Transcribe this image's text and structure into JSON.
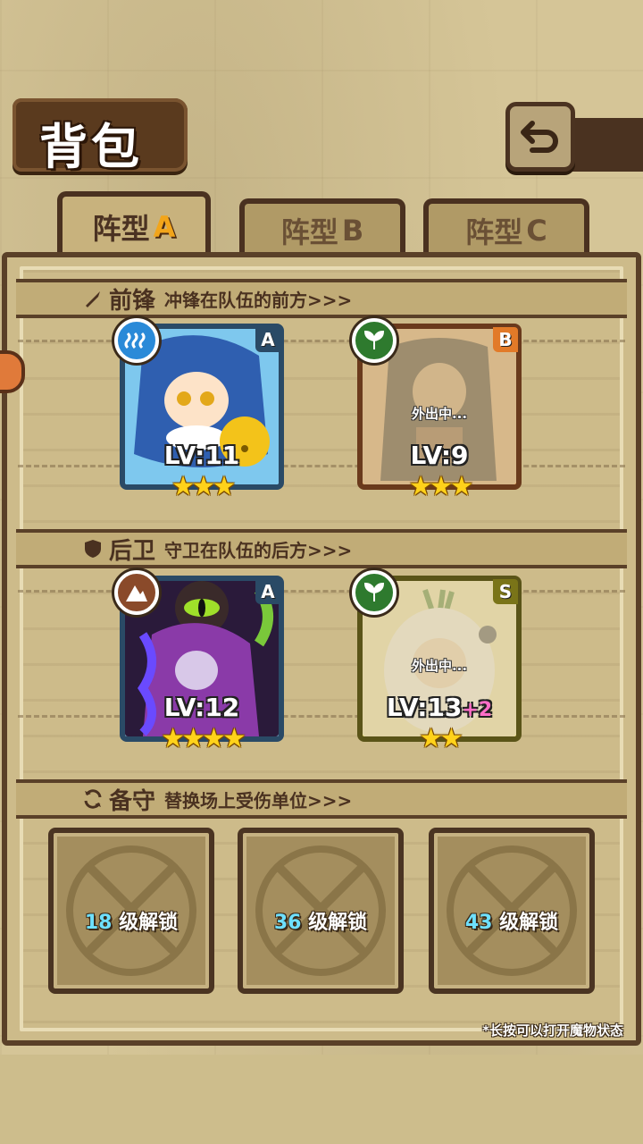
{
  "header": {
    "title": "背包"
  },
  "tabs": [
    {
      "label": "阵型",
      "letter": "A",
      "active": true
    },
    {
      "label": "阵型",
      "letter": "B",
      "active": false
    },
    {
      "label": "阵型",
      "letter": "C",
      "active": false
    }
  ],
  "sections": {
    "front": {
      "name": "前锋",
      "desc": "冲锋在队伍的前方>>>"
    },
    "rear": {
      "name": "后卫",
      "desc": "守卫在队伍的后方>>>"
    },
    "reserve": {
      "name": "备守",
      "desc": "替换场上受伤单位>>>"
    }
  },
  "cards": [
    {
      "rank": "A",
      "element": "water",
      "level": "LV:11",
      "bonus": "",
      "stars": "★★★",
      "status": ""
    },
    {
      "rank": "B",
      "element": "nature",
      "level": "LV:9",
      "bonus": "",
      "stars": "★★★",
      "status": "外出中..."
    },
    {
      "rank": "A",
      "element": "earth",
      "level": "LV:12",
      "bonus": "",
      "stars": "★★★★",
      "status": ""
    },
    {
      "rank": "S",
      "element": "nature",
      "level": "LV:13",
      "bonus": "+2",
      "stars": "★★",
      "status": "外出中..."
    }
  ],
  "locked_slots": [
    {
      "level": "18",
      "text": "级解锁"
    },
    {
      "level": "36",
      "text": "级解锁"
    },
    {
      "level": "43",
      "text": "级解锁"
    }
  ],
  "footer": {
    "hint": "*长按可以打开魔物状态"
  },
  "colors": {
    "panel": "#cdbb8a",
    "frame": "#5a4028",
    "accent": "#f2a51a",
    "water": "#2a8ad8",
    "nature": "#2e7a2e",
    "earth": "#8a4a2a"
  }
}
